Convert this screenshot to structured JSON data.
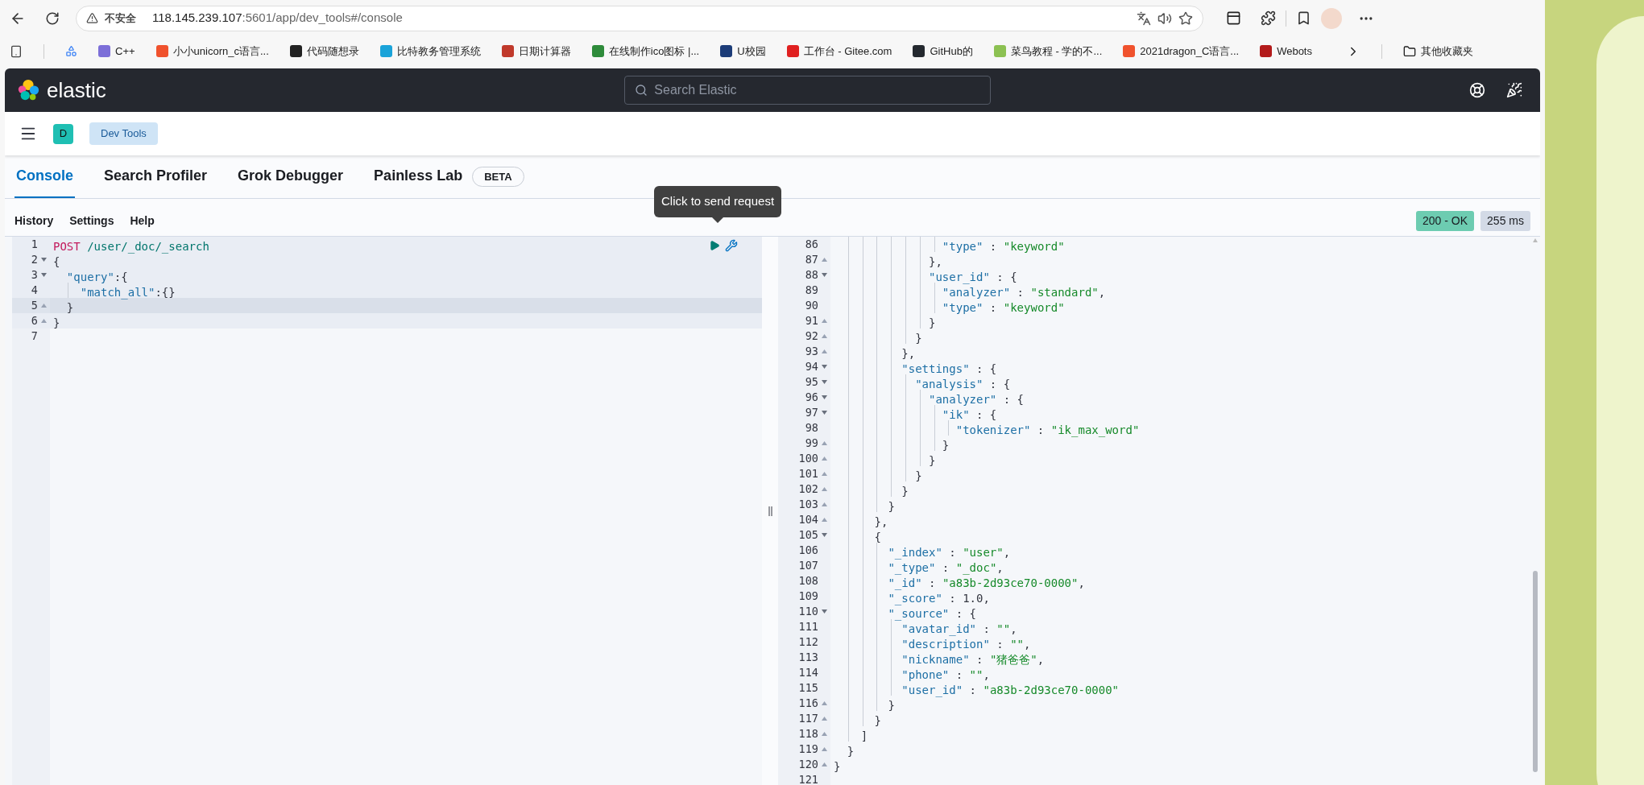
{
  "browser": {
    "security_label": "不安全",
    "url_host": "118.145.239.107",
    "url_path": ":5601/app/dev_tools#/console"
  },
  "bookmarks": [
    {
      "label": "C++",
      "color": "#7c6fd8"
    },
    {
      "label": "小小unicorn_c语言...",
      "color": "#f0522d"
    },
    {
      "label": "代码随想录",
      "color": "#222222"
    },
    {
      "label": "比特教务管理系统",
      "color": "#1aa3d9"
    },
    {
      "label": "日期计算器",
      "color": "#c0392b"
    },
    {
      "label": "在线制作ico图标 |...",
      "color": "#2e8b3a"
    },
    {
      "label": "U校园",
      "color": "#1c3c78"
    },
    {
      "label": "工作台 - Gitee.com",
      "color": "#e02020"
    },
    {
      "label": "GitHub的",
      "color": "#24292f"
    },
    {
      "label": "菜鸟教程 - 学的不...",
      "color": "#8cc152"
    },
    {
      "label": "2021dragon_C语言...",
      "color": "#f0522d"
    },
    {
      "label": "Webots",
      "color": "#b31b1b"
    }
  ],
  "other_bookmarks": "其他收藏夹",
  "app": {
    "logo_text": "elastic",
    "search_placeholder": "Search Elastic",
    "space_initial": "D",
    "breadcrumb": "Dev Tools"
  },
  "tabs": [
    {
      "label": "Console",
      "selected": true
    },
    {
      "label": "Search Profiler",
      "selected": false
    },
    {
      "label": "Grok Debugger",
      "selected": false
    },
    {
      "label": "Painless Lab",
      "selected": false,
      "badge": "BETA"
    }
  ],
  "toolbar": [
    "History",
    "Settings",
    "Help"
  ],
  "tooltip": "Click to send request",
  "status": {
    "code": "200 - OK",
    "time": "255 ms"
  },
  "request_lines": [
    {
      "number": "1",
      "active": false,
      "in_request": true,
      "fold_start": false,
      "fold_end": false,
      "tokens": [
        {
          "kind": "method",
          "text": "POST"
        },
        {
          "kind": "url",
          "text": " /user/_doc/_search"
        }
      ]
    },
    {
      "number": "2",
      "active": false,
      "in_request": true,
      "fold_start": true,
      "fold_end": false,
      "tokens": [
        {
          "kind": "punct",
          "text": "{"
        }
      ]
    },
    {
      "number": "3",
      "active": false,
      "in_request": true,
      "fold_start": true,
      "fold_end": false,
      "tokens": [
        {
          "kind": "key",
          "text": "  \"query\""
        },
        {
          "kind": "punct",
          "text": ":{"
        }
      ]
    },
    {
      "number": "4",
      "active": false,
      "in_request": true,
      "fold_start": false,
      "fold_end": false,
      "tokens": [
        {
          "kind": "key",
          "text": "    \"match_all\""
        },
        {
          "kind": "punct",
          "text": ":{}"
        }
      ]
    },
    {
      "number": "5",
      "active": true,
      "in_request": true,
      "fold_start": false,
      "fold_end": true,
      "tokens": [
        {
          "kind": "punct",
          "text": "  }"
        }
      ]
    },
    {
      "number": "6",
      "active": false,
      "in_request": true,
      "fold_start": false,
      "fold_end": true,
      "tokens": [
        {
          "kind": "punct",
          "text": "}"
        }
      ]
    },
    {
      "number": "7",
      "active": false,
      "in_request": false,
      "fold_start": false,
      "fold_end": false
    }
  ],
  "response_lines": [
    {
      "number": "86",
      "fold_start": false,
      "fold_end": false,
      "tokens": [
        {
          "kind": "key",
          "text": "                \"type\""
        },
        {
          "kind": "punct",
          "text": " : "
        },
        {
          "kind": "string",
          "text": "\"keyword\""
        }
      ]
    },
    {
      "number": "87",
      "fold_start": false,
      "fold_end": true,
      "tokens": [
        {
          "kind": "punct",
          "text": "              },"
        }
      ]
    },
    {
      "number": "88",
      "fold_start": true,
      "fold_end": false,
      "tokens": [
        {
          "kind": "key",
          "text": "              \"user_id\""
        },
        {
          "kind": "punct",
          "text": " : {"
        }
      ]
    },
    {
      "number": "89",
      "fold_start": false,
      "fold_end": false,
      "tokens": [
        {
          "kind": "key",
          "text": "                \"analyzer\""
        },
        {
          "kind": "punct",
          "text": " : "
        },
        {
          "kind": "string",
          "text": "\"standard\""
        },
        {
          "kind": "punct",
          "text": ","
        }
      ]
    },
    {
      "number": "90",
      "fold_start": false,
      "fold_end": false,
      "tokens": [
        {
          "kind": "key",
          "text": "                \"type\""
        },
        {
          "kind": "punct",
          "text": " : "
        },
        {
          "kind": "string",
          "text": "\"keyword\""
        }
      ]
    },
    {
      "number": "91",
      "fold_start": false,
      "fold_end": true,
      "tokens": [
        {
          "kind": "punct",
          "text": "              }"
        }
      ]
    },
    {
      "number": "92",
      "fold_start": false,
      "fold_end": true,
      "tokens": [
        {
          "kind": "punct",
          "text": "            }"
        }
      ]
    },
    {
      "number": "93",
      "fold_start": false,
      "fold_end": true,
      "tokens": [
        {
          "kind": "punct",
          "text": "          },"
        }
      ]
    },
    {
      "number": "94",
      "fold_start": true,
      "fold_end": false,
      "tokens": [
        {
          "kind": "key",
          "text": "          \"settings\""
        },
        {
          "kind": "punct",
          "text": " : {"
        }
      ]
    },
    {
      "number": "95",
      "fold_start": true,
      "fold_end": false,
      "tokens": [
        {
          "kind": "key",
          "text": "            \"analysis\""
        },
        {
          "kind": "punct",
          "text": " : {"
        }
      ]
    },
    {
      "number": "96",
      "fold_start": true,
      "fold_end": false,
      "tokens": [
        {
          "kind": "key",
          "text": "              \"analyzer\""
        },
        {
          "kind": "punct",
          "text": " : {"
        }
      ]
    },
    {
      "number": "97",
      "fold_start": true,
      "fold_end": false,
      "tokens": [
        {
          "kind": "key",
          "text": "                \"ik\""
        },
        {
          "kind": "punct",
          "text": " : {"
        }
      ]
    },
    {
      "number": "98",
      "fold_start": false,
      "fold_end": false,
      "tokens": [
        {
          "kind": "key",
          "text": "                  \"tokenizer\""
        },
        {
          "kind": "punct",
          "text": " : "
        },
        {
          "kind": "string",
          "text": "\"ik_max_word\""
        }
      ]
    },
    {
      "number": "99",
      "fold_start": false,
      "fold_end": true,
      "tokens": [
        {
          "kind": "punct",
          "text": "                }"
        }
      ]
    },
    {
      "number": "100",
      "fold_start": false,
      "fold_end": true,
      "tokens": [
        {
          "kind": "punct",
          "text": "              }"
        }
      ]
    },
    {
      "number": "101",
      "fold_start": false,
      "fold_end": true,
      "tokens": [
        {
          "kind": "punct",
          "text": "            }"
        }
      ]
    },
    {
      "number": "102",
      "fold_start": false,
      "fold_end": true,
      "tokens": [
        {
          "kind": "punct",
          "text": "          }"
        }
      ]
    },
    {
      "number": "103",
      "fold_start": false,
      "fold_end": true,
      "tokens": [
        {
          "kind": "punct",
          "text": "        }"
        }
      ]
    },
    {
      "number": "104",
      "fold_start": false,
      "fold_end": true,
      "tokens": [
        {
          "kind": "punct",
          "text": "      },"
        }
      ]
    },
    {
      "number": "105",
      "fold_start": true,
      "fold_end": false,
      "tokens": [
        {
          "kind": "punct",
          "text": "      {"
        }
      ]
    },
    {
      "number": "106",
      "fold_start": false,
      "fold_end": false,
      "tokens": [
        {
          "kind": "key",
          "text": "        \"_index\""
        },
        {
          "kind": "punct",
          "text": " : "
        },
        {
          "kind": "string",
          "text": "\"user\""
        },
        {
          "kind": "punct",
          "text": ","
        }
      ]
    },
    {
      "number": "107",
      "fold_start": false,
      "fold_end": false,
      "tokens": [
        {
          "kind": "key",
          "text": "        \"_type\""
        },
        {
          "kind": "punct",
          "text": " : "
        },
        {
          "kind": "string",
          "text": "\"_doc\""
        },
        {
          "kind": "punct",
          "text": ","
        }
      ]
    },
    {
      "number": "108",
      "fold_start": false,
      "fold_end": false,
      "tokens": [
        {
          "kind": "key",
          "text": "        \"_id\""
        },
        {
          "kind": "punct",
          "text": " : "
        },
        {
          "kind": "string",
          "text": "\"a83b-2d93ce70-0000\""
        },
        {
          "kind": "punct",
          "text": ","
        }
      ]
    },
    {
      "number": "109",
      "fold_start": false,
      "fold_end": false,
      "tokens": [
        {
          "kind": "key",
          "text": "        \"_score\""
        },
        {
          "kind": "punct",
          "text": " : "
        },
        {
          "kind": "number",
          "text": "1.0"
        },
        {
          "kind": "punct",
          "text": ","
        }
      ]
    },
    {
      "number": "110",
      "fold_start": true,
      "fold_end": false,
      "tokens": [
        {
          "kind": "key",
          "text": "        \"_source\""
        },
        {
          "kind": "punct",
          "text": " : {"
        }
      ]
    },
    {
      "number": "111",
      "fold_start": false,
      "fold_end": false,
      "tokens": [
        {
          "kind": "key",
          "text": "          \"avatar_id\""
        },
        {
          "kind": "punct",
          "text": " : "
        },
        {
          "kind": "string",
          "text": "\"\""
        },
        {
          "kind": "punct",
          "text": ","
        }
      ]
    },
    {
      "number": "112",
      "fold_start": false,
      "fold_end": false,
      "tokens": [
        {
          "kind": "key",
          "text": "          \"description\""
        },
        {
          "kind": "punct",
          "text": " : "
        },
        {
          "kind": "string",
          "text": "\"\""
        },
        {
          "kind": "punct",
          "text": ","
        }
      ]
    },
    {
      "number": "113",
      "fold_start": false,
      "fold_end": false,
      "tokens": [
        {
          "kind": "key",
          "text": "          \"nickname\""
        },
        {
          "kind": "punct",
          "text": " : "
        },
        {
          "kind": "string",
          "text": "\"猪爸爸\""
        },
        {
          "kind": "punct",
          "text": ","
        }
      ]
    },
    {
      "number": "114",
      "fold_start": false,
      "fold_end": false,
      "tokens": [
        {
          "kind": "key",
          "text": "          \"phone\""
        },
        {
          "kind": "punct",
          "text": " : "
        },
        {
          "kind": "string",
          "text": "\"\""
        },
        {
          "kind": "punct",
          "text": ","
        }
      ]
    },
    {
      "number": "115",
      "fold_start": false,
      "fold_end": false,
      "tokens": [
        {
          "kind": "key",
          "text": "          \"user_id\""
        },
        {
          "kind": "punct",
          "text": " : "
        },
        {
          "kind": "string",
          "text": "\"a83b-2d93ce70-0000\""
        }
      ]
    },
    {
      "number": "116",
      "fold_start": false,
      "fold_end": true,
      "tokens": [
        {
          "kind": "punct",
          "text": "        }"
        }
      ]
    },
    {
      "number": "117",
      "fold_start": false,
      "fold_end": true,
      "tokens": [
        {
          "kind": "punct",
          "text": "      }"
        }
      ]
    },
    {
      "number": "118",
      "fold_start": false,
      "fold_end": true,
      "tokens": [
        {
          "kind": "punct",
          "text": "    ]"
        }
      ]
    },
    {
      "number": "119",
      "fold_start": false,
      "fold_end": true,
      "tokens": [
        {
          "kind": "punct",
          "text": "  }"
        }
      ]
    },
    {
      "number": "120",
      "fold_start": false,
      "fold_end": true,
      "tokens": [
        {
          "kind": "punct",
          "text": "}"
        }
      ]
    },
    {
      "number": "121",
      "fold_start": false,
      "fold_end": false
    }
  ]
}
